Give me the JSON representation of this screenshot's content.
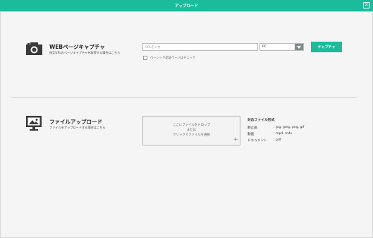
{
  "header": {
    "title": "アップロード",
    "close_label": "✕"
  },
  "web_capture": {
    "icon": "camera-icon",
    "title": "WEBページキャプチャ",
    "subtitle": "指定URLのページキャプチャを取得する場合はこちら",
    "url_placeholder": "URLを入力",
    "url_value": "",
    "device_selected": "PC",
    "capture_button": "キャプチャ",
    "basic_auth_label": "ベーシック認証ページはチェック",
    "basic_auth_checked": false
  },
  "file_upload": {
    "icon": "monitor-image-icon",
    "title": "ファイルアップロード",
    "subtitle": "ファイルをアップロードする場合はこちら",
    "dropzone": {
      "line1": "ここにファイルをドロップ",
      "line2": "または",
      "line3": "クリックでファイルを選択",
      "plus": "+"
    },
    "formats_title": "対応ファイル形式",
    "formats": [
      {
        "label": "静止画",
        "value": ": jpg, jpeg, png, gif"
      },
      {
        "label": "動画",
        "value": ": mp4, m4v"
      },
      {
        "label": "ドキュメント",
        "value": ": pdf"
      }
    ]
  },
  "colors": {
    "accent": "#1bbc9b",
    "select_arrow_bg": "#7e8c8d",
    "background": "#f5f5f5"
  }
}
